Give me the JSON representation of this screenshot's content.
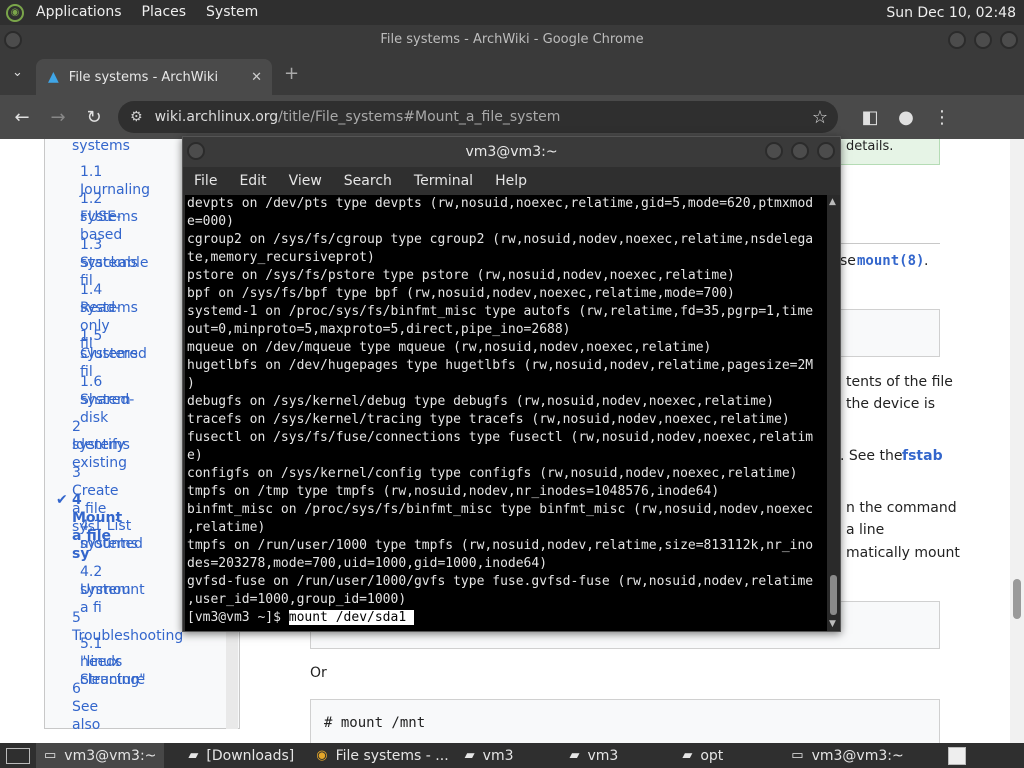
{
  "top_panel": {
    "menus": [
      "Applications",
      "Places",
      "System"
    ],
    "clock": "Sun Dec 10, 02:48"
  },
  "chrome": {
    "window_title": "File systems - ArchWiki - Google Chrome",
    "tab_title": "File systems - ArchWiki",
    "url_host": "wiki.archlinux.org",
    "url_path": "/title/File_systems#Mount_a_file_system"
  },
  "toc": {
    "items": [
      {
        "label": "systems",
        "top": 0
      },
      {
        "label": "1.1  Journaling"
      },
      {
        "label": "1.2  FUSE-based"
      },
      {
        "label": "systems"
      },
      {
        "label": "1.3  Stackable fil"
      },
      {
        "label": "systems"
      },
      {
        "label": "1.4  Read-only fil"
      },
      {
        "label": "systems"
      },
      {
        "label": "1.5  Clustered fil"
      },
      {
        "label": "systems"
      },
      {
        "label": "1.6  Shared-disk"
      },
      {
        "label": "system"
      },
      {
        "label": "2  Identify existing"
      },
      {
        "label": "systems"
      },
      {
        "label": "3  Create a file sys"
      },
      {
        "label": "4  Mount a file sy"
      },
      {
        "label": "4.1  List mounted"
      },
      {
        "label": "systems"
      },
      {
        "label": "4.2  Unmount a fi"
      },
      {
        "label": "system"
      },
      {
        "label": "5  Troubleshooting"
      },
      {
        "label": "5.1  \"linux Structure"
      },
      {
        "label": "needs cleaning\""
      },
      {
        "label": "6  See also"
      }
    ]
  },
  "page_fragments": {
    "details": "details.",
    "mount8": "mount(8)",
    "period": ".",
    "se": "se ",
    "contents": "tents of the file",
    "device": "the device is",
    "see_the": ". See the ",
    "fstab": "fstab",
    "command": "n the command",
    "aline": "a line",
    "automount": "matically mount",
    "or": "Or",
    "code2": "# mount /mnt"
  },
  "terminal": {
    "title": "vm3@vm3:~",
    "menu": [
      "File",
      "Edit",
      "View",
      "Search",
      "Terminal",
      "Help"
    ],
    "lines": [
      "devpts on /dev/pts type devpts (rw,nosuid,noexec,relatime,gid=5,mode=620,ptmxmod",
      "e=000)",
      "cgroup2 on /sys/fs/cgroup type cgroup2 (rw,nosuid,nodev,noexec,relatime,nsdelega",
      "te,memory_recursiveprot)",
      "pstore on /sys/fs/pstore type pstore (rw,nosuid,nodev,noexec,relatime)",
      "bpf on /sys/fs/bpf type bpf (rw,nosuid,nodev,noexec,relatime,mode=700)",
      "systemd-1 on /proc/sys/fs/binfmt_misc type autofs (rw,relatime,fd=35,pgrp=1,time",
      "out=0,minproto=5,maxproto=5,direct,pipe_ino=2688)",
      "mqueue on /dev/mqueue type mqueue (rw,nosuid,nodev,noexec,relatime)",
      "hugetlbfs on /dev/hugepages type hugetlbfs (rw,nosuid,nodev,relatime,pagesize=2M",
      ")",
      "debugfs on /sys/kernel/debug type debugfs (rw,nosuid,nodev,noexec,relatime)",
      "tracefs on /sys/kernel/tracing type tracefs (rw,nosuid,nodev,noexec,relatime)",
      "fusectl on /sys/fs/fuse/connections type fusectl (rw,nosuid,nodev,noexec,relatim",
      "e)",
      "configfs on /sys/kernel/config type configfs (rw,nosuid,nodev,noexec,relatime)",
      "tmpfs on /tmp type tmpfs (rw,nosuid,nodev,nr_inodes=1048576,inode64)",
      "binfmt_misc on /proc/sys/fs/binfmt_misc type binfmt_misc (rw,nosuid,nodev,noexec",
      ",relatime)",
      "tmpfs on /run/user/1000 type tmpfs (rw,nosuid,nodev,relatime,size=813112k,nr_ino",
      "des=203278,mode=700,uid=1000,gid=1000,inode64)",
      "gvfsd-fuse on /run/user/1000/gvfs type fuse.gvfsd-fuse (rw,nosuid,nodev,relatime",
      ",user_id=1000,group_id=1000)"
    ],
    "prompt": "[vm3@vm3 ~]$ ",
    "command": "mount /dev/sda1"
  },
  "taskbar": {
    "tasks": [
      {
        "icon": "terminal-icon",
        "label": "vm3@vm3:~",
        "active": true
      },
      {
        "icon": "folder-icon",
        "label": "[Downloads]"
      },
      {
        "icon": "chrome-icon",
        "label": "File systems - ..."
      },
      {
        "icon": "folder-icon",
        "label": "vm3"
      },
      {
        "icon": "folder-icon",
        "label": "vm3"
      },
      {
        "icon": "folder-icon",
        "label": "opt"
      },
      {
        "icon": "terminal-icon",
        "label": "vm3@vm3:~"
      }
    ]
  },
  "colors": {
    "link": "#3366cc",
    "terminal_bg": "#000000",
    "panel_bg": "#2f2f2f"
  }
}
